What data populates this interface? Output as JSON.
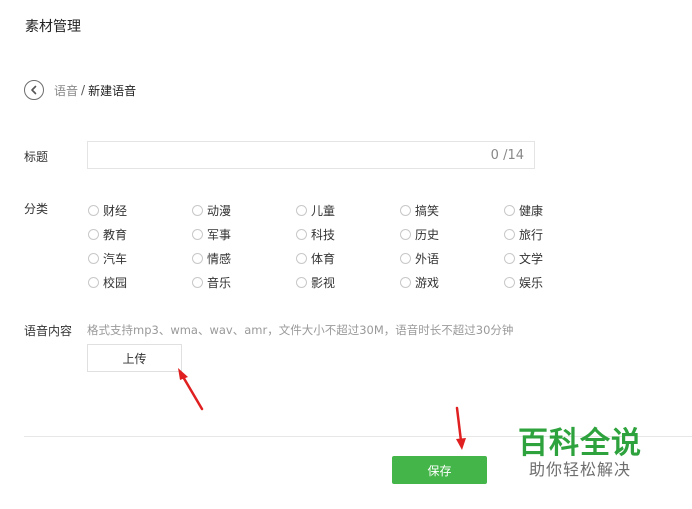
{
  "page": {
    "title": "素材管理"
  },
  "breadcrumb": {
    "parent": "语音",
    "separator": "/",
    "current": "新建语音"
  },
  "form": {
    "title_label": "标题",
    "title_value": "",
    "title_counter": "0 /14",
    "category_label": "分类",
    "categories": [
      "财经",
      "动漫",
      "儿童",
      "搞笑",
      "健康",
      "教育",
      "军事",
      "科技",
      "历史",
      "旅行",
      "汽车",
      "情感",
      "体育",
      "外语",
      "文学",
      "校园",
      "音乐",
      "影视",
      "游戏",
      "娱乐"
    ],
    "content_label": "语音内容",
    "content_hint": "格式支持mp3、wma、wav、amr，文件大小不超过30M，语音时长不超过30分钟",
    "upload_label": "上传"
  },
  "actions": {
    "save_label": "保存"
  },
  "watermark": {
    "title": "百科全说",
    "subtitle": "助你轻松解决"
  },
  "colors": {
    "primary_green": "#44b549",
    "annotation_red": "#e02020",
    "watermark_green": "#2ea33d"
  },
  "icons": {
    "back": "chevron-left-circle-icon"
  }
}
